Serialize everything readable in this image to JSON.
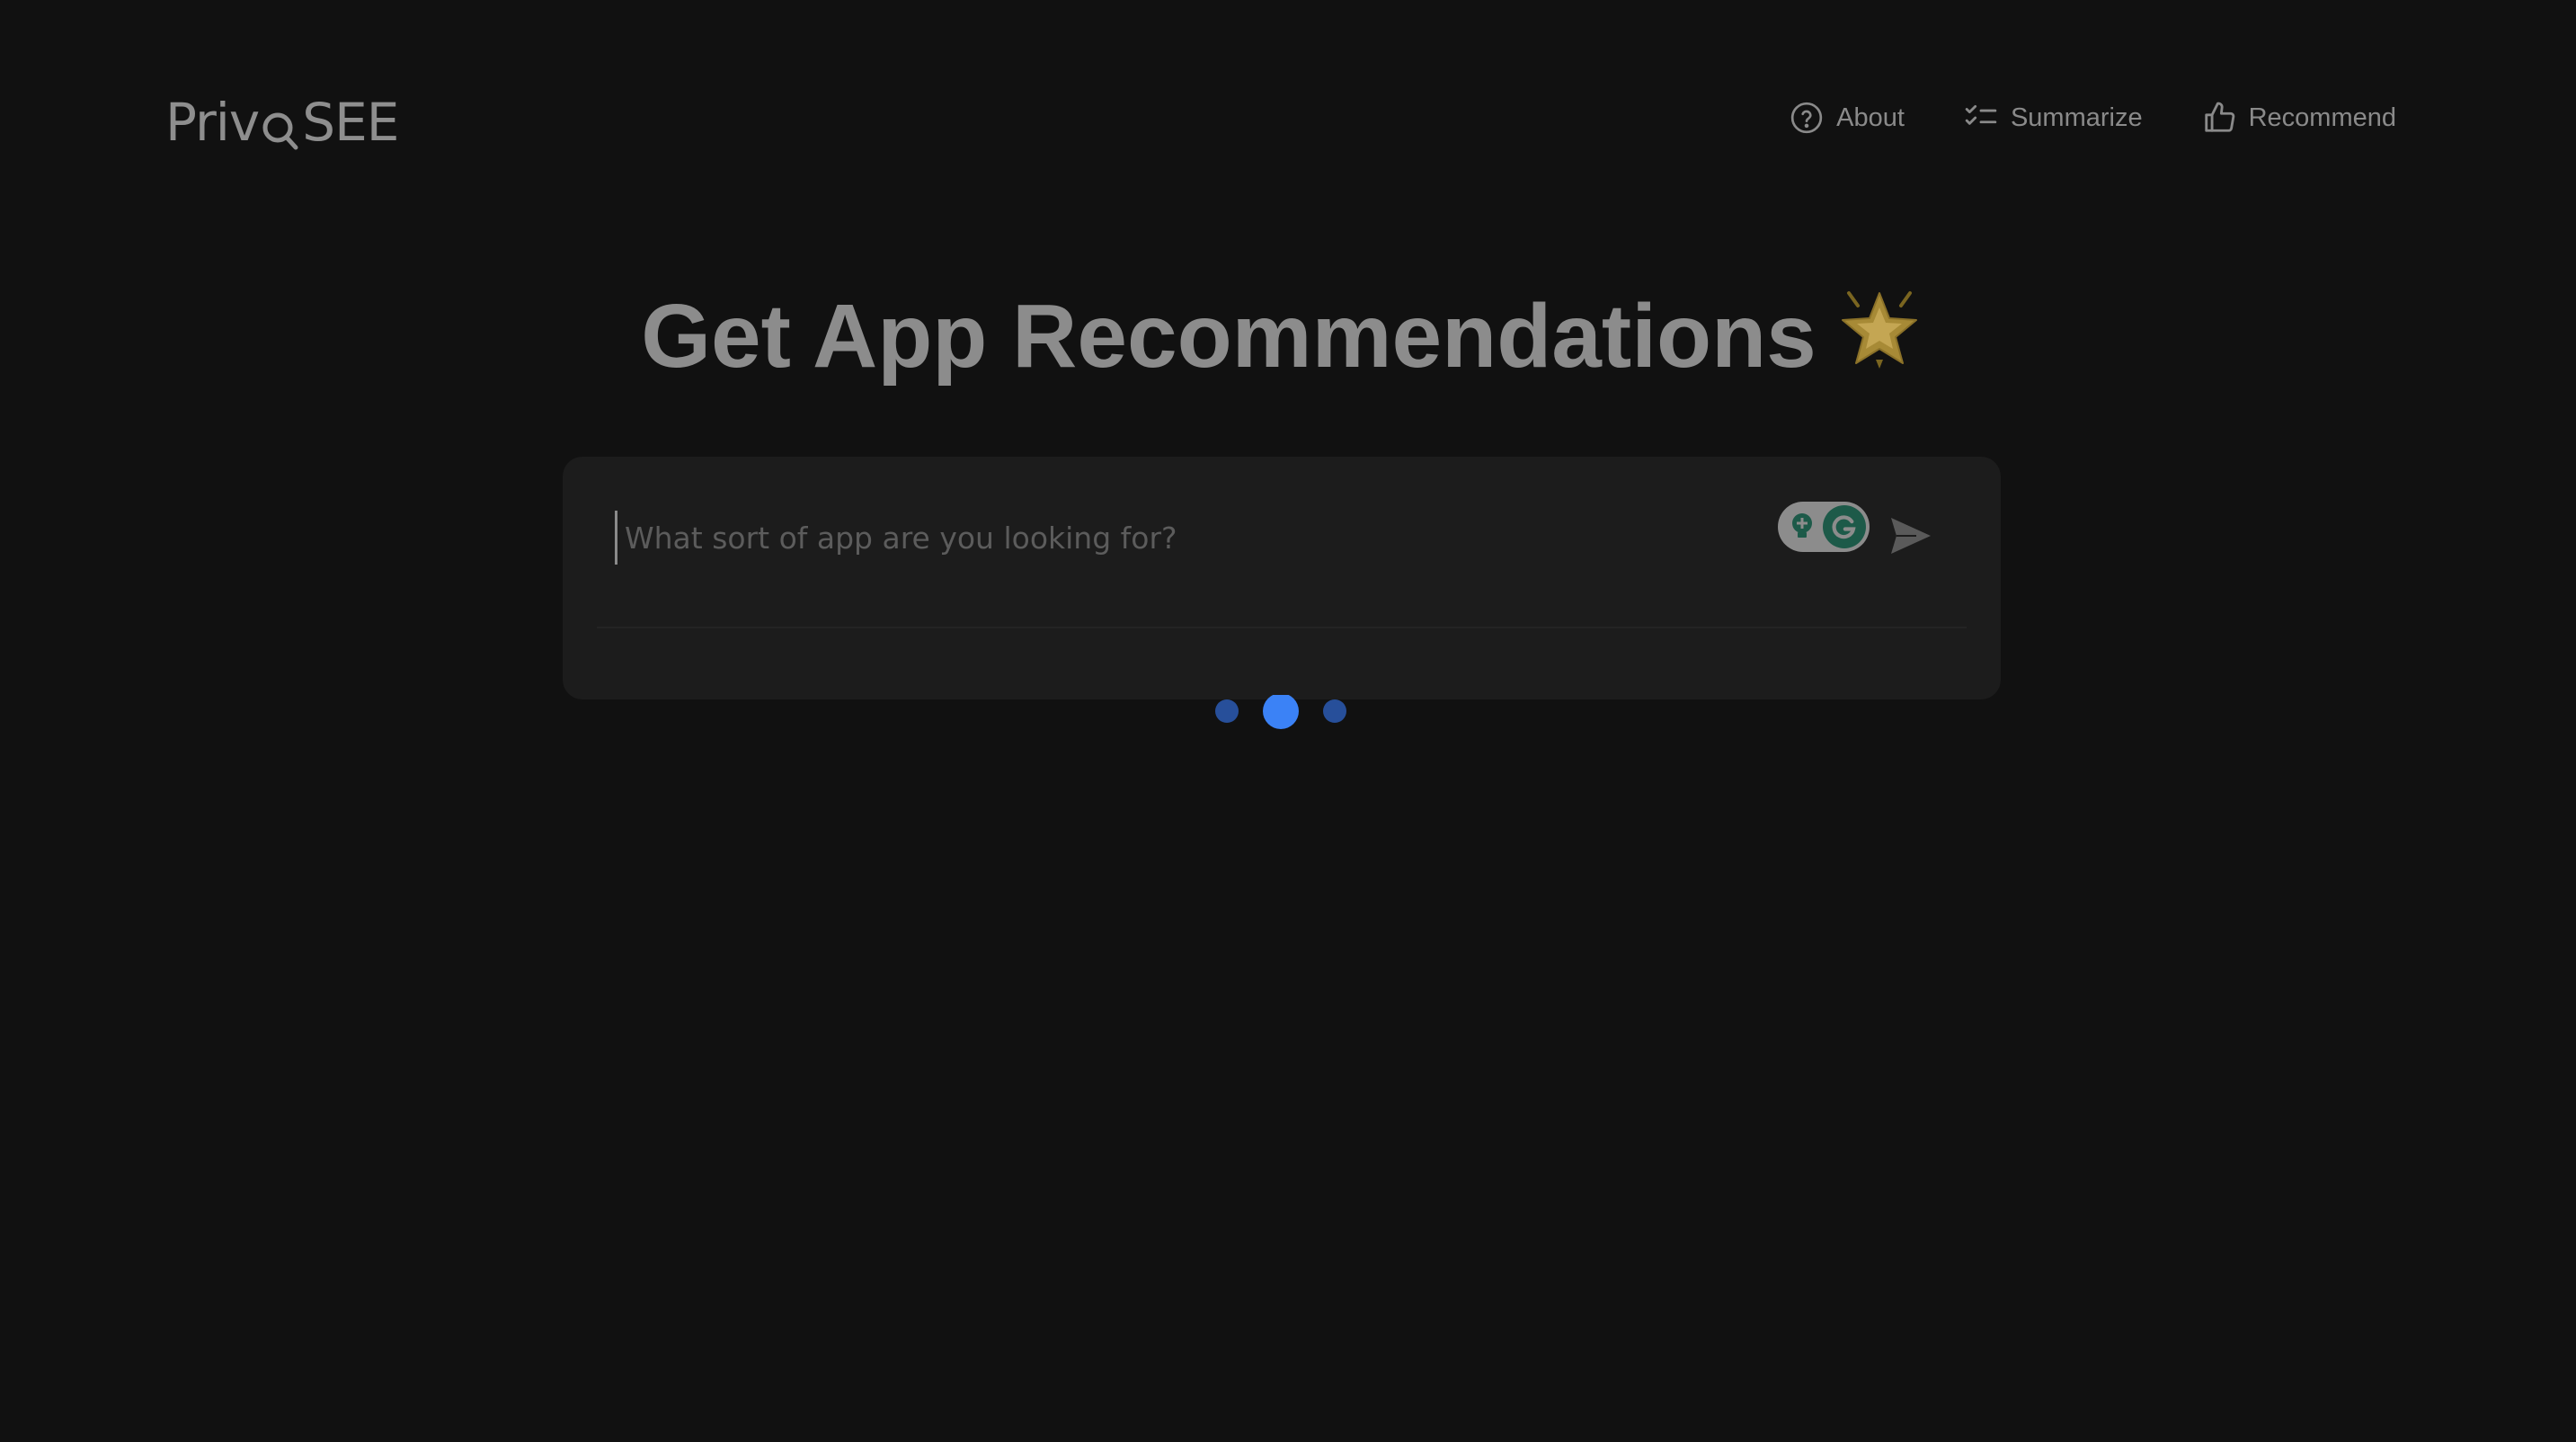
{
  "header": {
    "logo": "PrivoSEE",
    "logo_left": "Priv",
    "logo_right": "SEE",
    "nav": [
      {
        "label": "About",
        "icon": "question-circle-icon"
      },
      {
        "label": "Summarize",
        "icon": "checklist-icon"
      },
      {
        "label": "Recommend",
        "icon": "thumbs-up-icon"
      }
    ]
  },
  "main": {
    "title": "Get App Recommendations",
    "title_emoji_icon": "glowing-star-icon",
    "search": {
      "placeholder": "What sort of app are you looking for?",
      "value": ""
    },
    "extension_icon": "grammarly-icon",
    "send_icon": "send-icon",
    "loading_indicator": "loading-dots"
  },
  "colors": {
    "background": "#111111",
    "card": "#1c1c1c",
    "text_muted": "#8c8c8c",
    "accent": "#3b82f6"
  }
}
